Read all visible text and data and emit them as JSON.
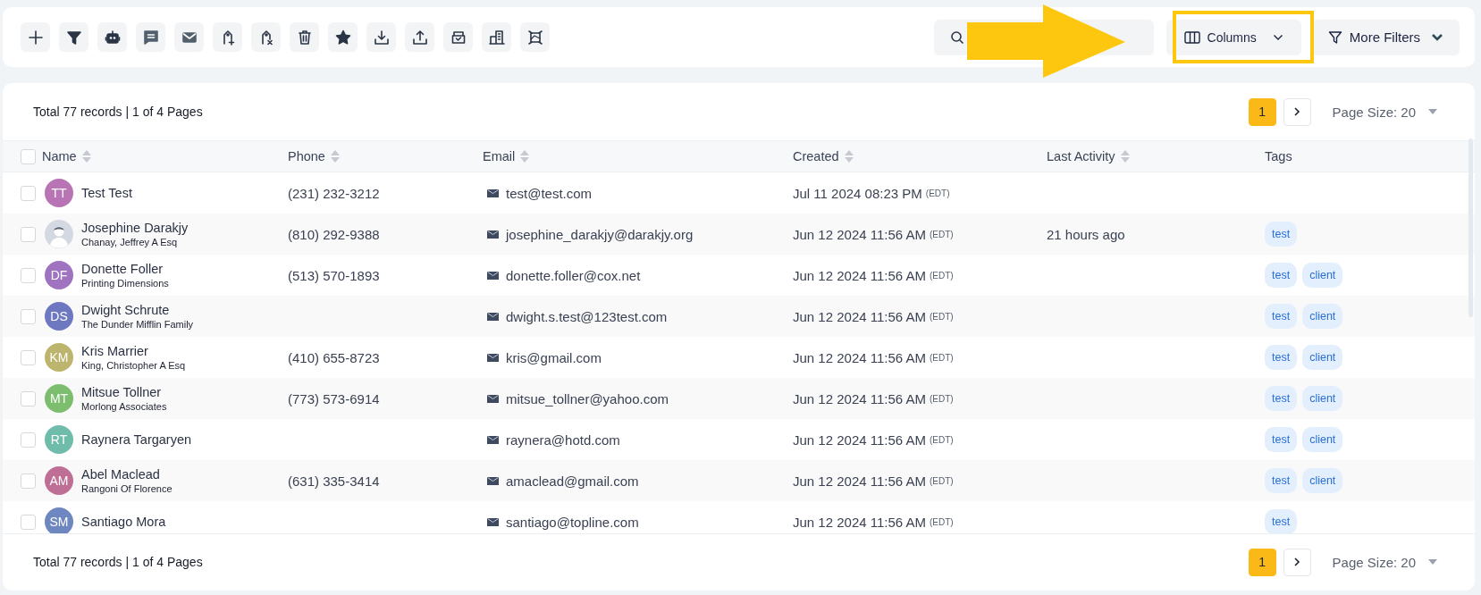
{
  "toolbar": {
    "columns_button": {
      "label": "Columns"
    },
    "more_filters_button": {
      "label": "More Filters"
    }
  },
  "annotations": {
    "arrow": {
      "color": "#fdc70f"
    },
    "highlight_box": {
      "color": "#fdc70f"
    }
  },
  "summary_top": "Total 77 records | 1 of 4 Pages",
  "pagination_top": {
    "pages": [
      {
        "label": "1",
        "selected": true
      }
    ],
    "page_size": "Page Size: 20"
  },
  "table": {
    "select_all_checked": false,
    "columns": [
      {
        "label": "Name",
        "sortable": true
      },
      {
        "label": "Phone",
        "sortable": true
      },
      {
        "label": "Email",
        "sortable": true
      },
      {
        "label": "Created",
        "sortable": true
      },
      {
        "label": "Last Activity",
        "sortable": true
      },
      {
        "label": "Tags",
        "sortable": false
      }
    ],
    "rows": [
      {
        "checked": false,
        "avatar": {
          "kind": "initials",
          "initials": "TT",
          "color": "#b874b4"
        },
        "name": "Test Test",
        "phone": "(231) 232-3212",
        "email": "test@test.com",
        "created": "Jul 11 2024 08:23 PM",
        "timezone": "(EDT)",
        "tags": []
      },
      {
        "checked": false,
        "avatar": {
          "kind": "silhouette"
        },
        "name": "Josephine Darakjy",
        "company": "Chanay, Jeffrey A Esq",
        "phone": "(810) 292-9388",
        "email": "josephine_darakjy@darakjy.org",
        "created": "Jun 12 2024 11:56 AM",
        "timezone": "(EDT)",
        "last_activity": "21 hours ago",
        "tags": [
          "test"
        ]
      },
      {
        "checked": false,
        "avatar": {
          "kind": "initials",
          "initials": "DF",
          "color": "#a073c0"
        },
        "name": "Donette Foller",
        "company": "Printing Dimensions",
        "phone": "(513) 570-1893",
        "email": "donette.foller@cox.net",
        "created": "Jun 12 2024 11:56 AM",
        "timezone": "(EDT)",
        "tags": [
          "test",
          "client"
        ]
      },
      {
        "checked": false,
        "avatar": {
          "kind": "initials",
          "initials": "DS",
          "color": "#6e78c0"
        },
        "name": "Dwight Schrute",
        "company": "The Dunder Mifflin Family",
        "email": "dwight.s.test@123test.com",
        "created": "Jun 12 2024 11:56 AM",
        "timezone": "(EDT)",
        "tags": [
          "test",
          "client"
        ]
      },
      {
        "checked": false,
        "avatar": {
          "kind": "initials",
          "initials": "KM",
          "color": "#bdb46e"
        },
        "name": "Kris Marrier",
        "company": "King, Christopher A Esq",
        "phone": "(410) 655-8723",
        "email": "kris@gmail.com",
        "created": "Jun 12 2024 11:56 AM",
        "timezone": "(EDT)",
        "tags": [
          "test",
          "client"
        ]
      },
      {
        "checked": false,
        "avatar": {
          "kind": "initials",
          "initials": "MT",
          "color": "#7cbd6e"
        },
        "name": "Mitsue Tollner",
        "company": "Morlong Associates",
        "phone": "(773) 573-6914",
        "email": "mitsue_tollner@yahoo.com",
        "created": "Jun 12 2024 11:56 AM",
        "timezone": "(EDT)",
        "tags": [
          "test",
          "client"
        ]
      },
      {
        "checked": false,
        "avatar": {
          "kind": "initials",
          "initials": "RT",
          "color": "#6fbcaa"
        },
        "name": "Raynera Targaryen",
        "email": "raynera@hotd.com",
        "created": "Jun 12 2024 11:56 AM",
        "timezone": "(EDT)",
        "tags": [
          "test",
          "client"
        ]
      },
      {
        "checked": false,
        "avatar": {
          "kind": "initials",
          "initials": "AM",
          "color": "#bf6e95"
        },
        "name": "Abel Maclead",
        "company": "Rangoni Of Florence",
        "phone": "(631) 335-3414",
        "email": "amaclead@gmail.com",
        "created": "Jun 12 2024 11:56 AM",
        "timezone": "(EDT)",
        "tags": [
          "test",
          "client"
        ]
      },
      {
        "checked": false,
        "avatar": {
          "kind": "initials",
          "initials": "SM",
          "color": "#6f87c0"
        },
        "name": "Santiago Mora",
        "email": "santiago@topline.com",
        "created": "Jun 12 2024 11:56 AM",
        "timezone": "(EDT)",
        "tags": [
          "test"
        ]
      }
    ]
  },
  "summary_bottom": "Total 77 records | 1 of 4 Pages",
  "pagination_bottom": {
    "pages": [
      {
        "label": "1",
        "selected": true
      }
    ],
    "page_size": "Page Size: 20"
  }
}
